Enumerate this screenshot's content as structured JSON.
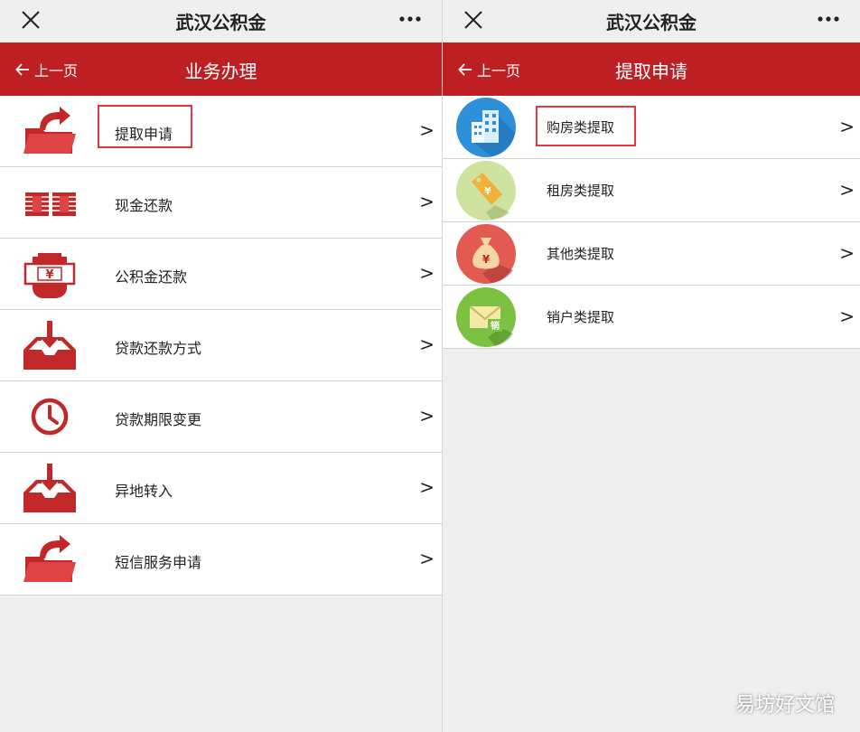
{
  "left": {
    "app_title": "武汉公积金",
    "back_label": "上一页",
    "page_title": "业务办理",
    "items": [
      {
        "label": "提取申请",
        "icon": "folder-arrow-icon"
      },
      {
        "label": "现金还款",
        "icon": "cash-stack-icon"
      },
      {
        "label": "公积金还款",
        "icon": "hand-yuan-icon"
      },
      {
        "label": "贷款还款方式",
        "icon": "inbox-download-icon"
      },
      {
        "label": "贷款期限变更",
        "icon": "clock-icon"
      },
      {
        "label": "异地转入",
        "icon": "inbox-download-icon"
      },
      {
        "label": "短信服务申请",
        "icon": "folder-arrow-icon"
      }
    ]
  },
  "right": {
    "app_title": "武汉公积金",
    "back_label": "上一页",
    "page_title": "提取申请",
    "items": [
      {
        "label": "购房类提取",
        "icon": "building-icon"
      },
      {
        "label": "租房类提取",
        "icon": "price-tag-yuan-icon"
      },
      {
        "label": "其他类提取",
        "icon": "money-bag-icon"
      },
      {
        "label": "销户类提取",
        "icon": "envelope-icon"
      }
    ],
    "tag_glyph": "¥",
    "bag_glyph": "¥",
    "envelope_glyph": "销"
  },
  "chevron": ">",
  "yuan_glyph": "¥",
  "watermark": "易坊好文馆",
  "colors": {
    "brand_red": "#bd1f22",
    "icon_red": "#c0282a",
    "highlight": "#e0383e"
  }
}
